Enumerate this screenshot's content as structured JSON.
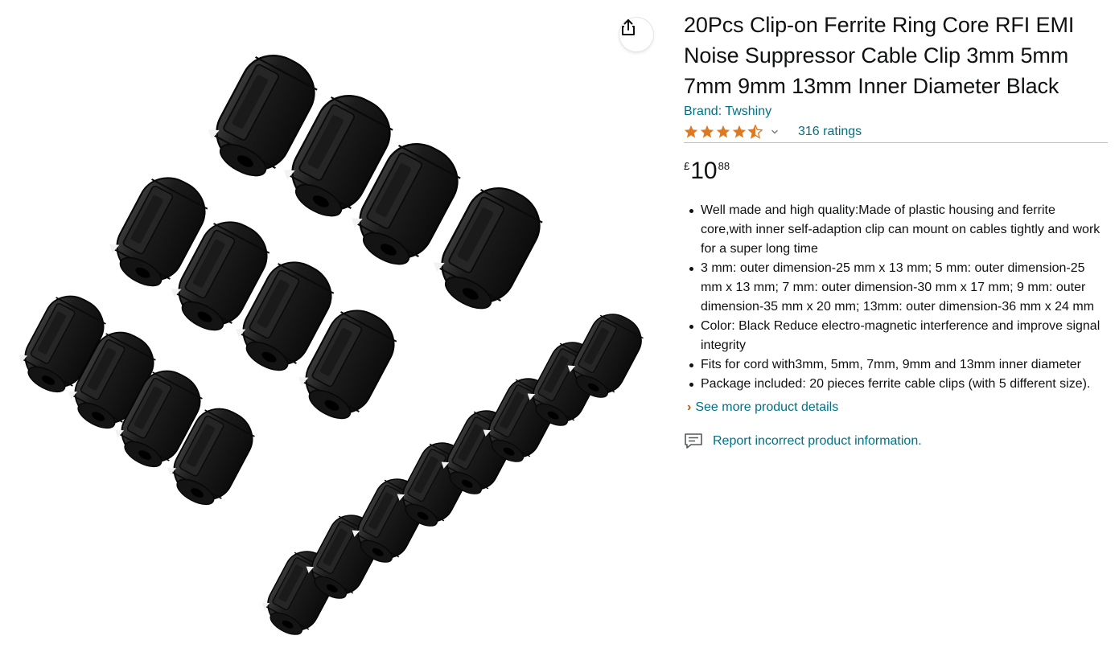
{
  "product": {
    "title": "20Pcs Clip-on Ferrite Ring Core RFI EMI Noise Suppressor Cable Clip 3mm 5mm 7mm 9mm 13mm Inner Diameter Black",
    "brand_label": "Brand: Twshiny",
    "rating": {
      "stars": 4.5,
      "count_label": "316 ratings"
    },
    "price": {
      "currency": "£",
      "whole": "10",
      "fraction": "88"
    },
    "bullets": [
      "Well made and high quality:Made of plastic housing and ferrite core,with inner self-adaption clip can mount on cables tightly and work for a super long time",
      "3 mm: outer dimension-25 mm x 13 mm; 5 mm: outer dimension-25 mm x 13 mm; 7 mm: outer dimension-30 mm x 17 mm; 9 mm: outer dimension-35 mm x 20 mm; 13mm: outer dimension-36 mm x 24 mm",
      "Color: Black Reduce electro-magnetic interference and improve signal integrity",
      "Fits for cord with3mm, 5mm, 7mm, 9mm and 13mm inner diameter",
      "Package included: 20 pieces ferrite cable clips (with 5 different size)."
    ],
    "see_more_label": "See more product details",
    "report_label": "Report incorrect product information."
  },
  "icons": {
    "share": "share-icon",
    "star": "star-icon",
    "chevron": "chevron-down-icon",
    "report": "report-feedback-icon"
  },
  "colors": {
    "link": "#007185",
    "star": "#de7921",
    "caret": "#c45500",
    "text": "#0f1111"
  }
}
